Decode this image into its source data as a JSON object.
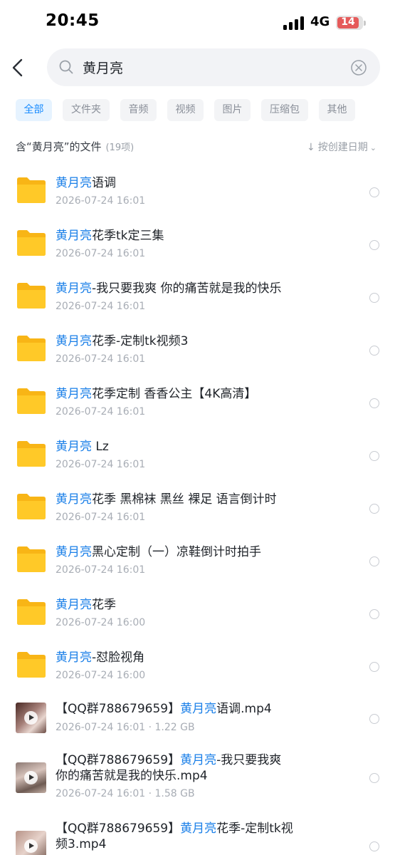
{
  "status_bar": {
    "time": "20:45",
    "network": "4G",
    "battery": "14"
  },
  "search": {
    "query": "黄月亮"
  },
  "filters": [
    "全部",
    "文件夹",
    "音频",
    "视频",
    "图片",
    "压缩包",
    "其他"
  ],
  "active_filter": "全部",
  "section": {
    "title": "含“黄月亮”的文件",
    "count": "(19项)"
  },
  "sort": {
    "label": "按创建日期"
  },
  "highlight_color": "#1a7fe8",
  "folders": [
    {
      "hl": "黄月亮",
      "rest": "语调",
      "date": "2026-07-24 16:01"
    },
    {
      "hl": "黄月亮",
      "rest": "花季tk定三集",
      "date": "2026-07-24 16:01"
    },
    {
      "hl": "黄月亮",
      "rest": "-我只要我爽 你的痛苦就是我的快乐",
      "date": "2026-07-24 16:01"
    },
    {
      "hl": "黄月亮",
      "rest": "花季-定制tk视频3",
      "date": "2026-07-24 16:01"
    },
    {
      "hl": "黄月亮",
      "rest": "花季定制 香香公主【4K高清】",
      "date": "2026-07-24 16:01"
    },
    {
      "hl": "黄月亮",
      "rest": " Lz",
      "date": "2026-07-24 16:01"
    },
    {
      "hl": "黄月亮",
      "rest": "花季 黑棉袜 黑丝 裸足 语言倒计时",
      "date": "2026-07-24 16:01"
    },
    {
      "hl": "黄月亮",
      "rest": "黑心定制（一）凉鞋倒计时拍手",
      "date": "2026-07-24 16:01"
    },
    {
      "hl": "黄月亮",
      "rest": "花季",
      "date": "2026-07-24 16:00"
    },
    {
      "hl": "黄月亮",
      "rest": "-怼脸视角",
      "date": "2026-07-24 16:00"
    }
  ],
  "videos": [
    {
      "pre": "【QQ群788679659】",
      "hl": "黄月亮",
      "line1": "语调.mp4",
      "line2": "",
      "meta": "2026-07-24 16:01 · 1.22 GB"
    },
    {
      "pre": "【QQ群788679659】",
      "hl": "黄月亮",
      "line1": "-我只要我爽",
      "line2": "你的痛苦就是我的快乐.mp4",
      "meta": "2026-07-24 16:01 · 1.58 GB"
    },
    {
      "pre": "【QQ群788679659】",
      "hl": "黄月亮",
      "line1": "花季-定制tk视",
      "line2": "频3.mp4",
      "meta": ""
    }
  ]
}
